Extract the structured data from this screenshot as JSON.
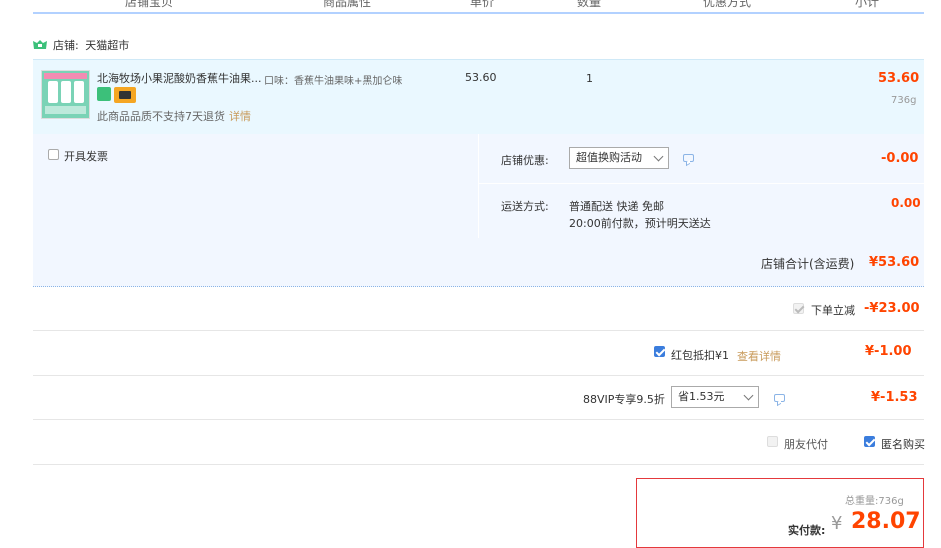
{
  "header": {
    "cols": [
      "店铺宝贝",
      "商品属性",
      "单价",
      "数量",
      "优惠方式",
      "小计"
    ]
  },
  "shop": {
    "label": "店铺:",
    "name": "天猫超市",
    "icon": "tmall-shop-icon",
    "icon_color": "#3cc07a"
  },
  "item": {
    "name": "北海牧场小果泥酸奶香蕉牛油果...",
    "attr": "口味：香蕉牛油果味+黑加仑味",
    "unit_price": "53.60",
    "qty": "1",
    "subtotal": "53.60",
    "weight": "736g",
    "return_note": "此商品品质不支持7天退货",
    "return_link": "详情"
  },
  "options": {
    "invoice_label": "开具发票",
    "shop_discount_label": "店铺优惠:",
    "shop_discount_select": "超值换购活动",
    "shop_discount_amount": "-0.00",
    "shipping_label": "运送方式:",
    "shipping_method": "普通配送 快递 免邮",
    "shipping_note": "20:00前付款，预计明天送达",
    "shipping_amount": "0.00"
  },
  "shop_total": {
    "label": "店铺合计(含运费)",
    "value": "¥53.60"
  },
  "discounts": {
    "instant_label": "下单立减",
    "instant_value": "-¥23.00",
    "redpacket_label": "红包抵扣¥1",
    "redpacket_link": "查看详情",
    "redpacket_value": "¥-1.00",
    "vip_label": "88VIP专享9.5折",
    "vip_select": "省1.53元",
    "vip_value": "¥-1.53"
  },
  "checkout_opts": {
    "friend_pay": "朋友代付",
    "anonymous": "匿名购买"
  },
  "pay": {
    "weight_label": "总重量:",
    "weight_value": "736g",
    "actual_label": "实付款:",
    "currency": "¥",
    "amount": "28.07"
  },
  "colors": {
    "accent_red": "#f40",
    "header_border": "#b2d1ff",
    "item_bg": "#eaf8ff",
    "opt_bg": "#f2f7ff"
  }
}
